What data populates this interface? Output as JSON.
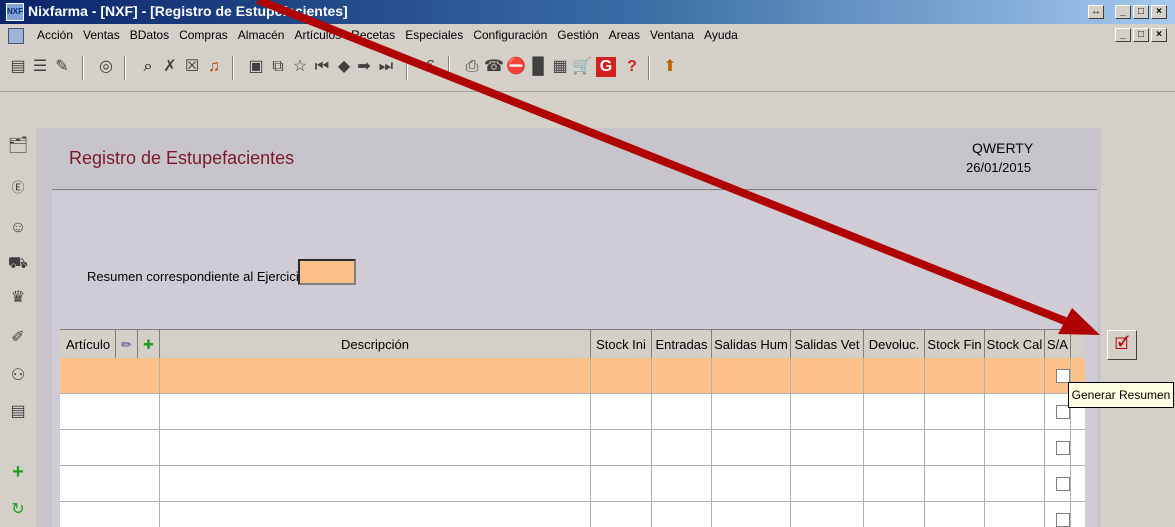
{
  "window": {
    "title": "Nixfarma - [NXF] - [Registro de Estupefacientes]",
    "controls": [
      "_",
      "□",
      "×"
    ]
  },
  "menu": [
    "Acción",
    "Ventas",
    "BDatos",
    "Compras",
    "Almacén",
    "Artículos",
    "Recetas",
    "Especiales",
    "Configuración",
    "Gestión",
    "Areas",
    "Ventana",
    "Ayuda"
  ],
  "form": {
    "title": "Registro de Estupefacientes",
    "company": "QWERTY",
    "date": "26/01/2015",
    "ejercicio_label": "Resumen correspondiente al Ejercicio",
    "ejercicio_value": ""
  },
  "table": {
    "columns": [
      "Artículo",
      "Descripción",
      "Stock Ini",
      "Entradas",
      "Salidas Hum",
      "Salidas Vet",
      "Devoluc.",
      "Stock Fin",
      "Stock Cal",
      "S/A"
    ],
    "rows": 5
  },
  "actions": {
    "generate_button": "Generar Resumen",
    "tooltip": "Generar Resumen"
  },
  "colors": {
    "selected_row": "#fcc08a",
    "title_text": "#7b1a28",
    "annotation_arrow": "#b00000"
  },
  "icons": {
    "toolbar": [
      "new-icon",
      "edit-icon",
      "print-icon",
      "search-icon",
      "copy-icon",
      "cancel-icon",
      "save-icon",
      "list-icon",
      "star-icon",
      "back-icon",
      "left-arrow-icon",
      "right-arrow-icon",
      "exit-icon",
      "euro-icon",
      "printer-icon",
      "phone-icon",
      "stop-icon",
      "notes-icon",
      "cart-icon",
      "g-icon",
      "help-icon",
      "upload-icon"
    ],
    "sidebar": [
      "sales-icon",
      "euro-coin-icon",
      "person-icon",
      "cart-icon",
      "factory-icon",
      "pencil-icon",
      "people-icon",
      "register-icon",
      "add-icon",
      "refresh-icon"
    ]
  }
}
